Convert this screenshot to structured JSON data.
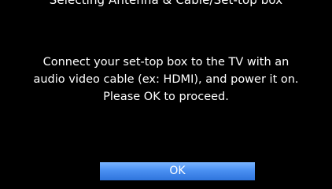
{
  "dialog": {
    "title": "Selecting Antenna & Cable/Set-top box",
    "message_lines": [
      "Connect your set-top box to the TV with an",
      "audio video cable (ex: HDMI), and power it on.",
      "Please OK to proceed."
    ],
    "ok_label": "OK"
  },
  "colors": {
    "background": "#000000",
    "text": "#ffffff",
    "button_highlight": "#4a90f2"
  }
}
